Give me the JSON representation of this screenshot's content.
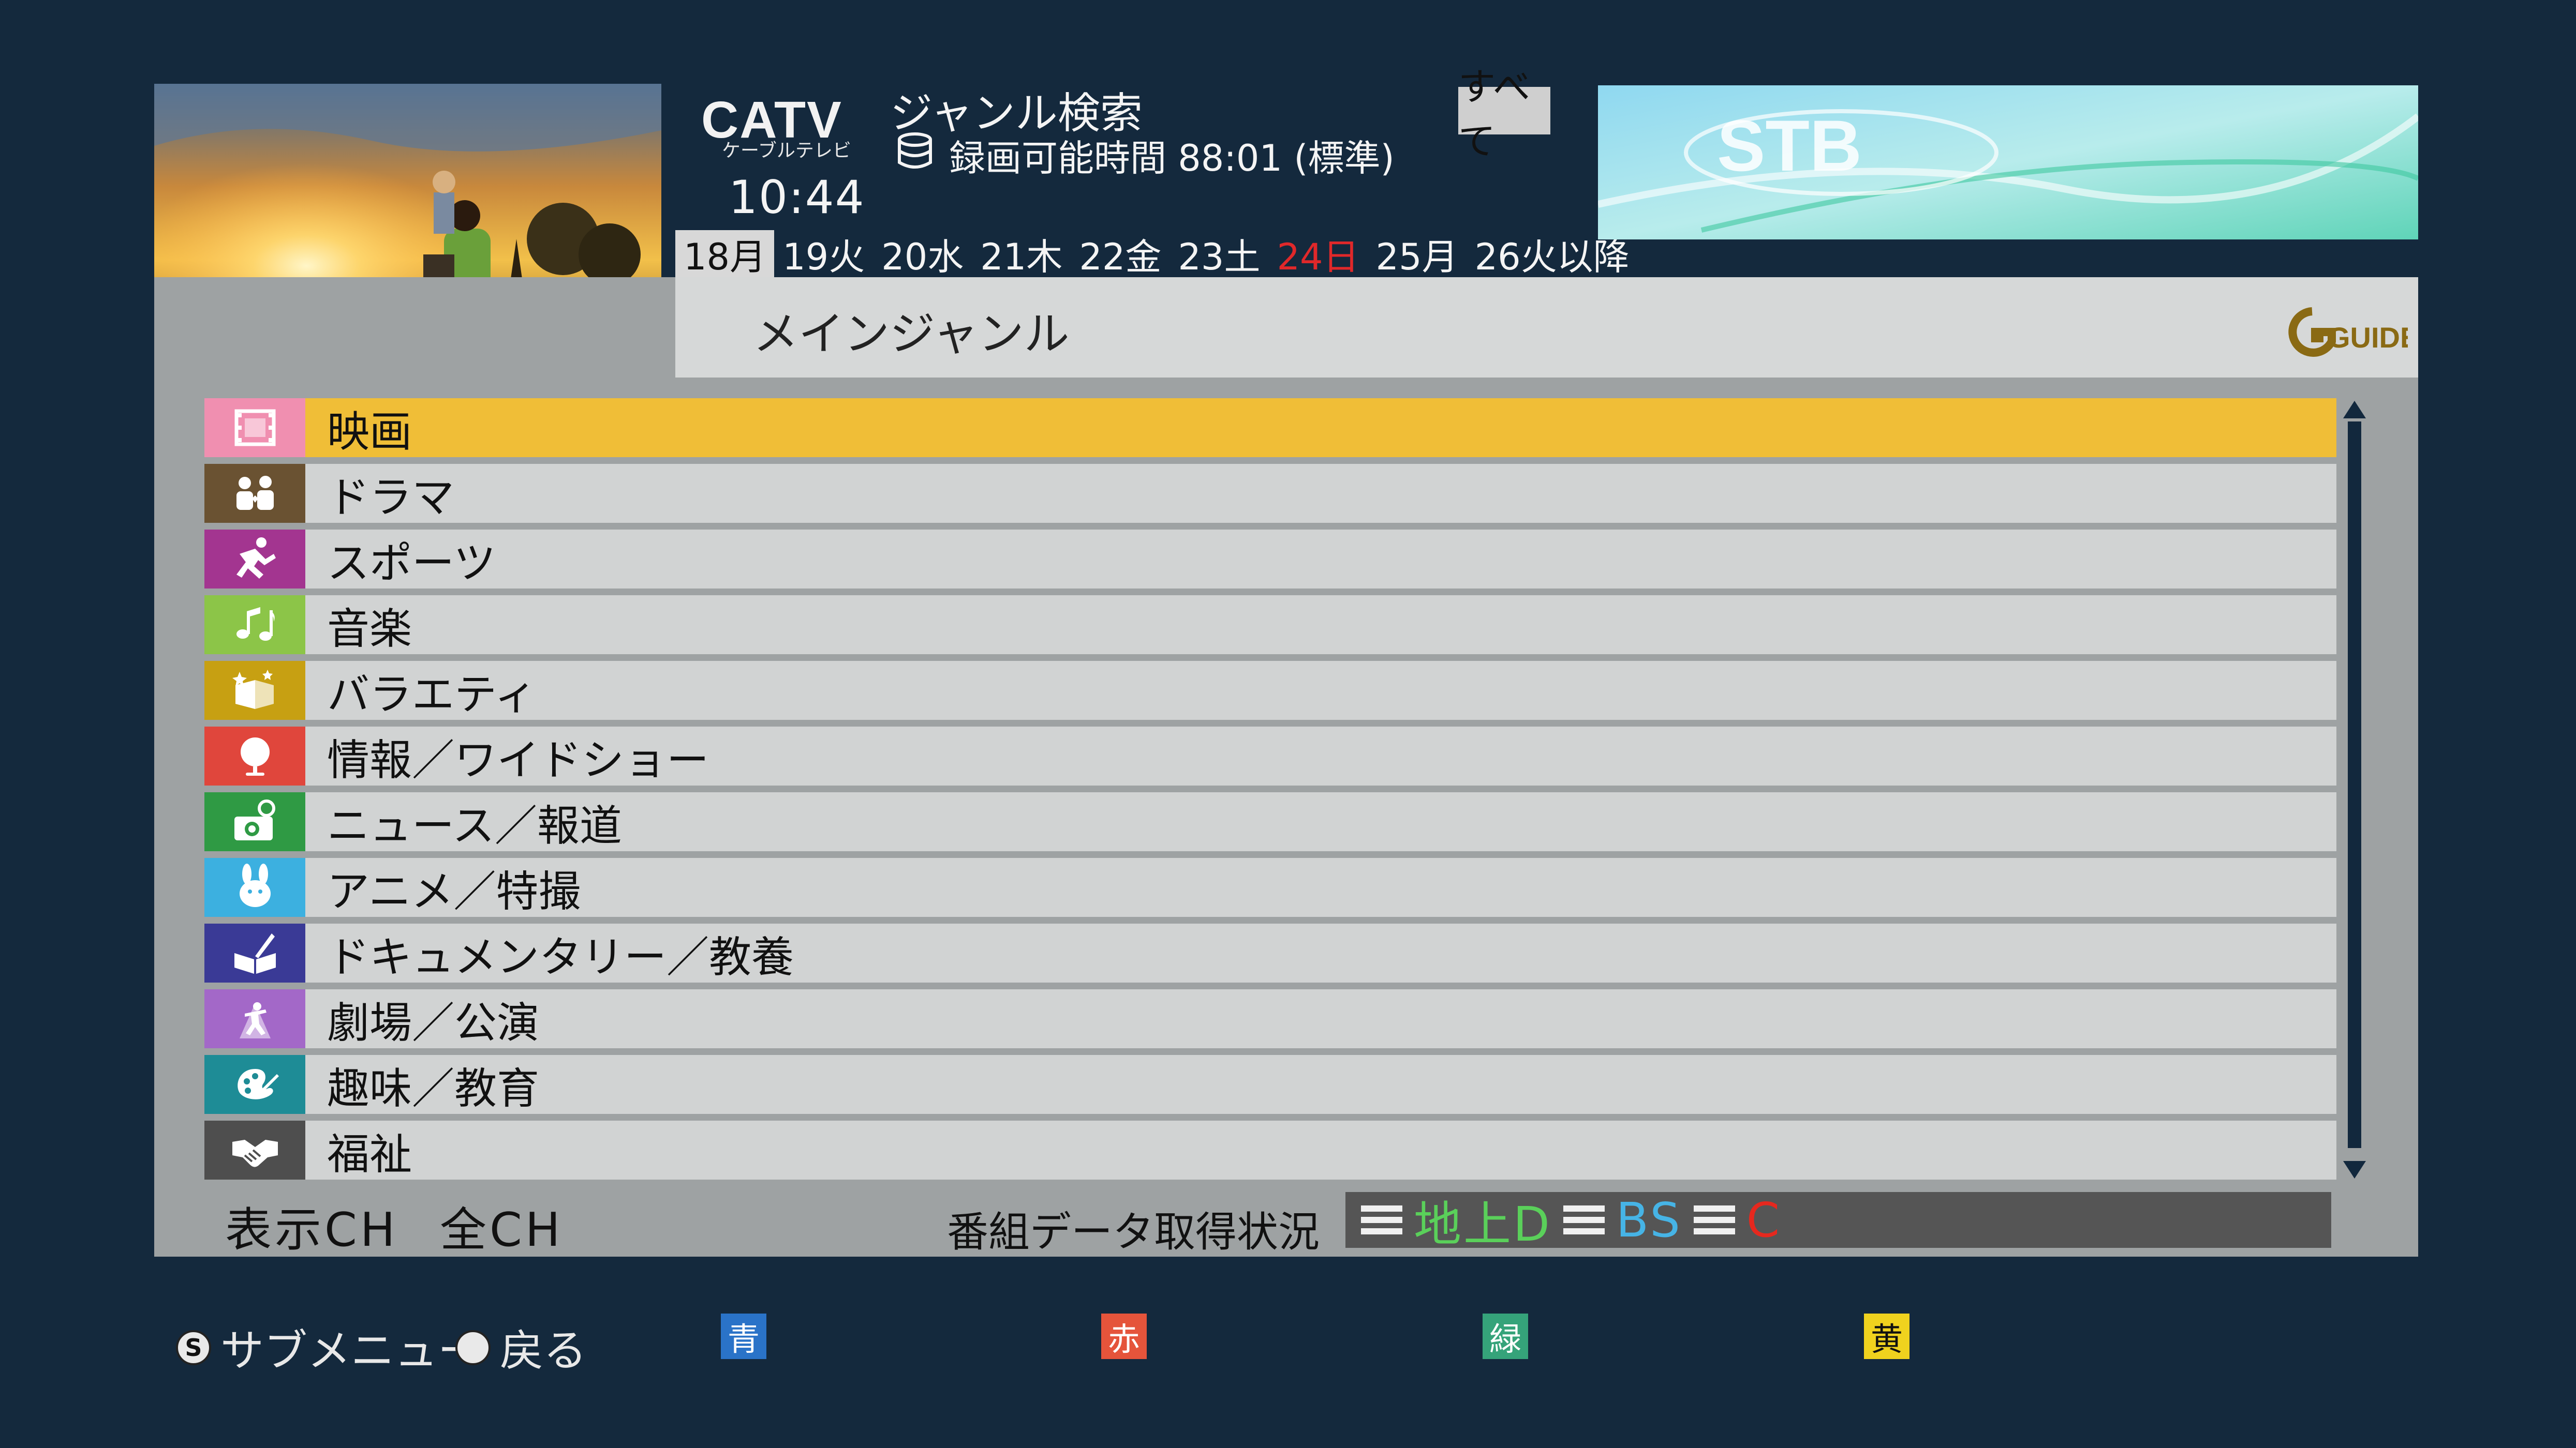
{
  "header": {
    "logo": "CATV",
    "logo_sub": "ケーブルテレビ",
    "clock": "10:44",
    "title": "ジャンル検索",
    "rec_label": "録画可能時間 88:01 (標準)",
    "filter_badge": "すべて"
  },
  "days": [
    {
      "label": "18月",
      "selected": true
    },
    {
      "label": "19火"
    },
    {
      "label": "20水"
    },
    {
      "label": "21木"
    },
    {
      "label": "22金"
    },
    {
      "label": "23土"
    },
    {
      "label": "24日",
      "color": "#e0282a"
    },
    {
      "label": "25月"
    },
    {
      "label": "26火以降"
    }
  ],
  "banner": {
    "text": "STB"
  },
  "panel": {
    "header_label": "メインジャンル",
    "logo_text": "GUIDE"
  },
  "genres": [
    {
      "label": "映画",
      "icon": "film-icon",
      "color": "#f08fb0",
      "selected": true
    },
    {
      "label": "ドラマ",
      "icon": "people-icon",
      "color": "#6a5232"
    },
    {
      "label": "スポーツ",
      "icon": "runner-icon",
      "color": "#a33590"
    },
    {
      "label": "音楽",
      "icon": "music-note-icon",
      "color": "#8cc548"
    },
    {
      "label": "バラエティ",
      "icon": "variety-box-icon",
      "color": "#c7a012"
    },
    {
      "label": "情報／ワイドショー",
      "icon": "globe-icon",
      "color": "#e0463c"
    },
    {
      "label": "ニュース／報道",
      "icon": "camera-icon",
      "color": "#2f9a44"
    },
    {
      "label": "アニメ／特撮",
      "icon": "bunny-icon",
      "color": "#3cb0e0"
    },
    {
      "label": "ドキュメンタリー／教養",
      "icon": "book-icon",
      "color": "#3a3a96"
    },
    {
      "label": "劇場／公演",
      "icon": "dancer-icon",
      "color": "#a368c8"
    },
    {
      "label": "趣味／教育",
      "icon": "palette-icon",
      "color": "#1e8c96"
    },
    {
      "label": "福祉",
      "icon": "handshake-icon",
      "color": "#4e4e4e"
    }
  ],
  "footer": {
    "display_ch_label": "表示CH",
    "display_ch_value": "全CH",
    "status_label": "番組データ取得状況",
    "statuses": [
      {
        "label": "地上D",
        "color": "#5ad05a"
      },
      {
        "label": "BS",
        "color": "#46b4e6"
      },
      {
        "label": "C",
        "color": "#e6281e"
      }
    ]
  },
  "bottom": {
    "submenu_key": "S",
    "submenu_label": "サブメニュー",
    "back_label": "戻る",
    "blue": "青",
    "red": "赤",
    "green": "緑",
    "yellow": "黄"
  },
  "colors": {
    "background": "#14293d",
    "panel": "#9ea2a3",
    "row": "#d1d3d3",
    "row_selected": "#f0be37",
    "blue_key": "#2a73c8",
    "red_key": "#e5543b",
    "green_key": "#35a37a",
    "yellow_key": "#f0d21e"
  }
}
